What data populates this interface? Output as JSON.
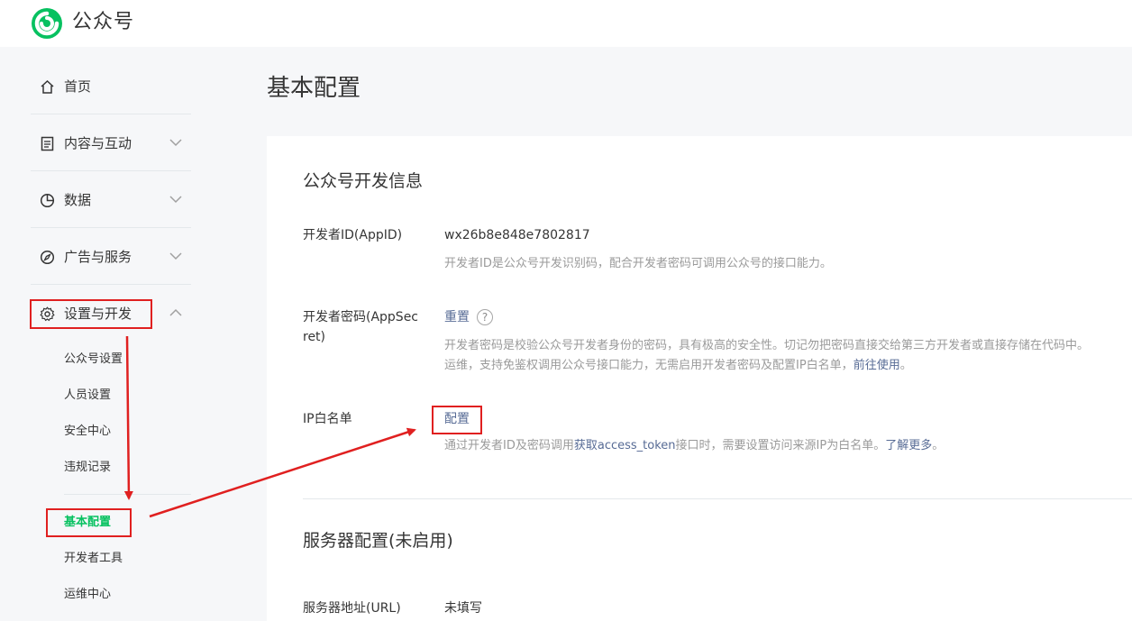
{
  "header": {
    "brand": "公众号",
    "logo_icon": "wechat-mp-logo-icon",
    "brand_color": "#07c160"
  },
  "sidebar": {
    "items": [
      {
        "label": "首页",
        "icon": "home-icon"
      },
      {
        "label": "内容与互动",
        "icon": "document-icon"
      },
      {
        "label": "数据",
        "icon": "pie-chart-icon"
      },
      {
        "label": "广告与服务",
        "icon": "compass-icon"
      },
      {
        "label": "设置与开发",
        "icon": "gear-icon"
      }
    ],
    "sub_items": [
      {
        "label": "公众号设置"
      },
      {
        "label": "人员设置"
      },
      {
        "label": "安全中心"
      },
      {
        "label": "违规记录"
      },
      {
        "label": "基本配置",
        "active": true
      },
      {
        "label": "开发者工具"
      },
      {
        "label": "运维中心"
      }
    ]
  },
  "main": {
    "title": "基本配置",
    "dev_info": {
      "title": "公众号开发信息",
      "appid_label": "开发者ID(AppID)",
      "appid_value": "wx26b8e848e7802817",
      "appid_desc": "开发者ID是公众号开发识别码，配合开发者密码可调用公众号的接口能力。",
      "secret_label_line1": "开发者密码(AppSec",
      "secret_label_line2": "ret)",
      "secret_reset": "重置",
      "secret_help": "?",
      "secret_desc_line1": "开发者密码是校验公众号开发者身份的密码，具有极高的安全性。切记勿把密码直接交给第三方开发者或直接存储在代码中。",
      "secret_desc_line2_prefix": "运维，支持免鉴权调用公众号接口能力，无需启用开发者密码及配置IP白名单，",
      "secret_desc_line2_link": "前往使用",
      "secret_desc_line2_suffix": "。",
      "ip_label": "IP白名单",
      "ip_config": "配置",
      "ip_desc_prefix": "通过开发者ID及密码调用",
      "ip_desc_link1": "获取access_token",
      "ip_desc_mid": "接口时，需要设置访问来源IP为白名单。",
      "ip_desc_link2": "了解更多",
      "ip_desc_suffix": "。"
    },
    "server_config": {
      "title": "服务器配置(未启用)",
      "url_label": "服务器地址(URL)",
      "url_value": "未填写"
    }
  },
  "annotation_color": "#e02020"
}
